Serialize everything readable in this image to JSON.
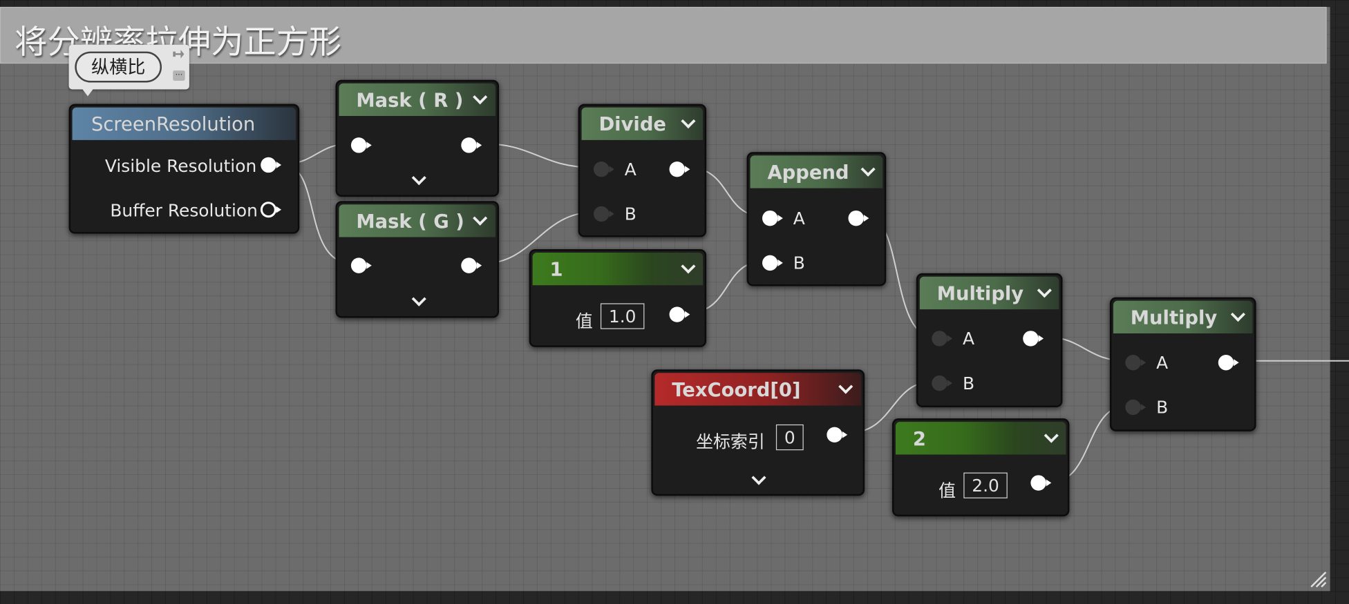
{
  "comment": {
    "title": "将分辨率拉伸为正方形",
    "bubble": "纵横比"
  },
  "nodes": {
    "screen_resolution": {
      "title": "ScreenResolution",
      "visible_label": "Visible Resolution",
      "buffer_label": "Buffer Resolution"
    },
    "mask_r": {
      "title": "Mask ( R )"
    },
    "mask_g": {
      "title": "Mask ( G )"
    },
    "divide": {
      "title": "Divide",
      "a": "A",
      "b": "B"
    },
    "const1": {
      "title": "1",
      "value_label": "值",
      "value": "1.0"
    },
    "append": {
      "title": "Append",
      "a": "A",
      "b": "B"
    },
    "texcoord": {
      "title": "TexCoord[0]",
      "index_label": "坐标索引",
      "index": "0"
    },
    "multiply1": {
      "title": "Multiply",
      "a": "A",
      "b": "B"
    },
    "const2": {
      "title": "2",
      "value_label": "值",
      "value": "2.0"
    },
    "multiply2": {
      "title": "Multiply",
      "a": "A",
      "b": "B"
    }
  },
  "colors": {
    "math_header": "#5a7c56",
    "constant_header": "#3d7a1e",
    "coord_header": "#b52a2a",
    "input_header": "#5e84a6",
    "pin_active": "#ffffff",
    "pin_inactive": "#3a3a3a",
    "wire": "#d8d8d8"
  }
}
